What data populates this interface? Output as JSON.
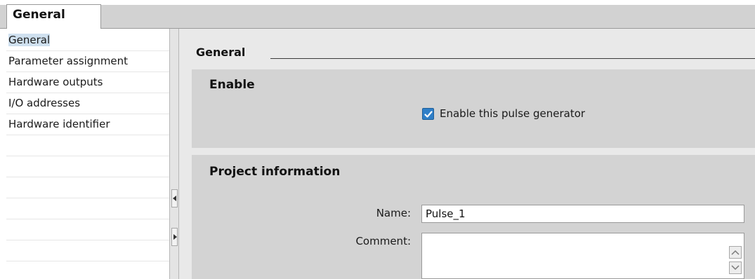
{
  "tab": {
    "label": "General"
  },
  "nav": {
    "items": [
      {
        "label": "General",
        "selected": true
      },
      {
        "label": "Parameter assignment",
        "selected": false
      },
      {
        "label": "Hardware outputs",
        "selected": false
      },
      {
        "label": "I/O addresses",
        "selected": false
      },
      {
        "label": "Hardware identifier",
        "selected": false
      }
    ]
  },
  "main": {
    "section_title": "General",
    "enable_group": {
      "title": "Enable",
      "checkbox_label": "Enable this pulse generator",
      "checked": true
    },
    "project_group": {
      "title": "Project information",
      "name_label": "Name:",
      "name_value": "Pulse_1",
      "comment_label": "Comment:",
      "comment_value": ""
    }
  },
  "colors": {
    "selected_item": "#cfe0ef",
    "group_bg": "#d3d3d3",
    "main_bg": "#e9e9e9",
    "checkbox": "#2f7fc8"
  },
  "icons": [
    "collapse-left-icon",
    "expand-right-icon",
    "checkmark-icon",
    "scroll-up-icon",
    "scroll-down-icon"
  ]
}
